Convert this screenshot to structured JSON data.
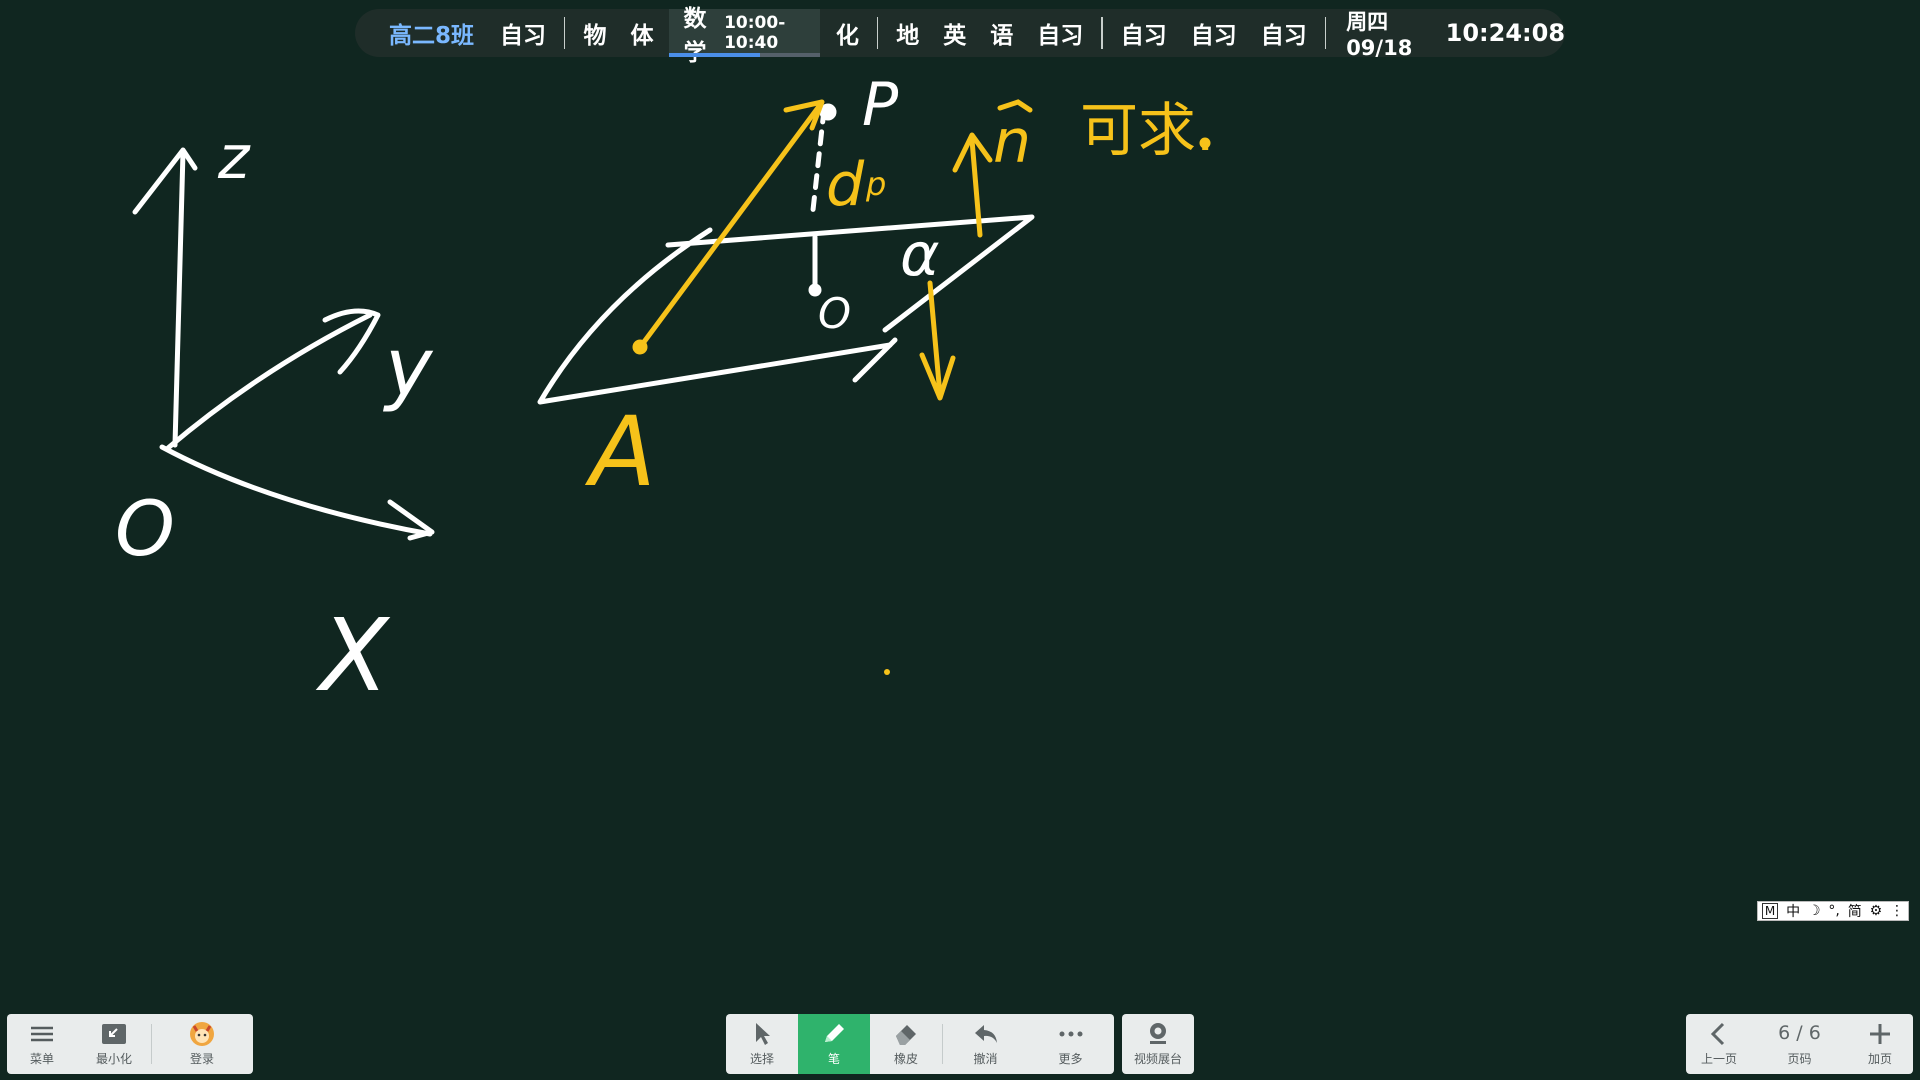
{
  "topbar": {
    "class_name": "高二8班",
    "schedule_1": [
      "自习"
    ],
    "schedule_2_a": [
      "物",
      "体"
    ],
    "current": {
      "subject": "数学",
      "time": "10:00-10:40",
      "progress": 0.6
    },
    "schedule_2_b": [
      "化"
    ],
    "schedule_3": [
      "地",
      "英",
      "语",
      "自习"
    ],
    "schedule_4": [
      "自习",
      "自习",
      "自习"
    ],
    "date": "周四 09/18",
    "clock": "10:24:08"
  },
  "board": {
    "labels": {
      "z": "z",
      "y": "y",
      "o_axis": "O",
      "x": "X",
      "A": "A",
      "P": "P",
      "d": "d",
      "O_point": "O",
      "alpha": "α",
      "n": "n",
      "note": "可求."
    },
    "colors": {
      "chalk": "#ffffff",
      "accent": "#f6c21a",
      "background": "#102620"
    }
  },
  "left_toolbar": {
    "menu": "菜单",
    "minimize": "最小化",
    "login": "登录"
  },
  "center_toolbar": {
    "select": "选择",
    "pen": "笔",
    "eraser": "橡皮",
    "undo": "撤消",
    "more": "更多",
    "video": "视频展台"
  },
  "right_toolbar": {
    "prev": "上一页",
    "page": "6 / 6",
    "page_label": "页码",
    "add": "加页"
  },
  "ime_bar": {
    "mode": "M",
    "lang": "中",
    "moon": "☽",
    "punct": "°,",
    "simp": "简",
    "gear": "⚙",
    "more": "⋮"
  },
  "icons": [
    "menu-icon",
    "minimize-icon",
    "avatar-icon",
    "cursor-icon",
    "pen-icon",
    "eraser-icon",
    "undo-icon",
    "more-icon",
    "camera-icon",
    "chevron-left-icon",
    "plus-icon"
  ]
}
